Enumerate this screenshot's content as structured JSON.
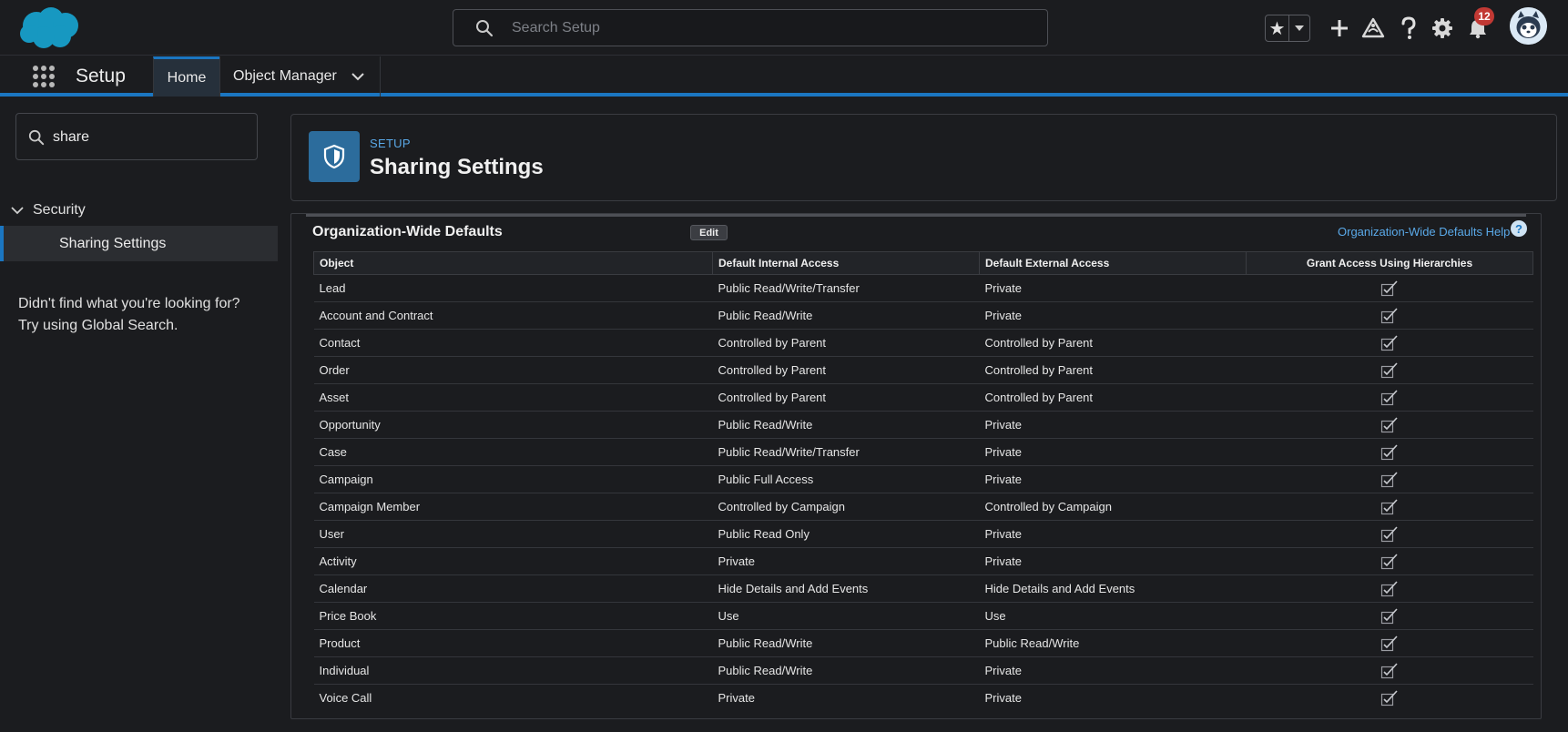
{
  "header": {
    "search_placeholder": "Search Setup",
    "notification_count": "12",
    "icons": [
      "salesforce-logo",
      "search-icon",
      "star-icon",
      "chevron-down-icon",
      "plus-icon",
      "trailhead-icon",
      "help-icon",
      "gear-icon",
      "bell-icon",
      "avatar"
    ]
  },
  "context_bar": {
    "app_name": "Setup",
    "tabs": [
      {
        "label": "Home",
        "active": true
      },
      {
        "label": "Object Manager",
        "active": false
      }
    ]
  },
  "sidebar": {
    "search_value": "share",
    "tree": {
      "group": "Security",
      "item": "Sharing Settings"
    },
    "not_found_line1": "Didn't find what you're looking for?",
    "not_found_line2": "Try using Global Search."
  },
  "page_header": {
    "eyebrow": "SETUP",
    "title": "Sharing Settings"
  },
  "section": {
    "title": "Organization-Wide Defaults",
    "edit_label": "Edit",
    "help_link": "Organization-Wide Defaults Help",
    "help_icon_glyph": "?"
  },
  "table": {
    "columns": [
      "Object",
      "Default Internal Access",
      "Default External Access",
      "Grant Access Using Hierarchies"
    ],
    "rows": [
      {
        "object": "Lead",
        "internal": "Public Read/Write/Transfer",
        "external": "Private"
      },
      {
        "object": "Account and Contract",
        "internal": "Public Read/Write",
        "external": "Private"
      },
      {
        "object": "Contact",
        "internal": "Controlled by Parent",
        "external": "Controlled by Parent"
      },
      {
        "object": "Order",
        "internal": "Controlled by Parent",
        "external": "Controlled by Parent"
      },
      {
        "object": "Asset",
        "internal": "Controlled by Parent",
        "external": "Controlled by Parent"
      },
      {
        "object": "Opportunity",
        "internal": "Public Read/Write",
        "external": "Private"
      },
      {
        "object": "Case",
        "internal": "Public Read/Write/Transfer",
        "external": "Private"
      },
      {
        "object": "Campaign",
        "internal": "Public Full Access",
        "external": "Private"
      },
      {
        "object": "Campaign Member",
        "internal": "Controlled by Campaign",
        "external": "Controlled by Campaign"
      },
      {
        "object": "User",
        "internal": "Public Read Only",
        "external": "Private"
      },
      {
        "object": "Activity",
        "internal": "Private",
        "external": "Private"
      },
      {
        "object": "Calendar",
        "internal": "Hide Details and Add Events",
        "external": "Hide Details and Add Events"
      },
      {
        "object": "Price Book",
        "internal": "Use",
        "external": "Use"
      },
      {
        "object": "Product",
        "internal": "Public Read/Write",
        "external": "Public Read/Write"
      },
      {
        "object": "Individual",
        "internal": "Public Read/Write",
        "external": "Private"
      },
      {
        "object": "Voice Call",
        "internal": "Private",
        "external": "Private"
      }
    ]
  }
}
